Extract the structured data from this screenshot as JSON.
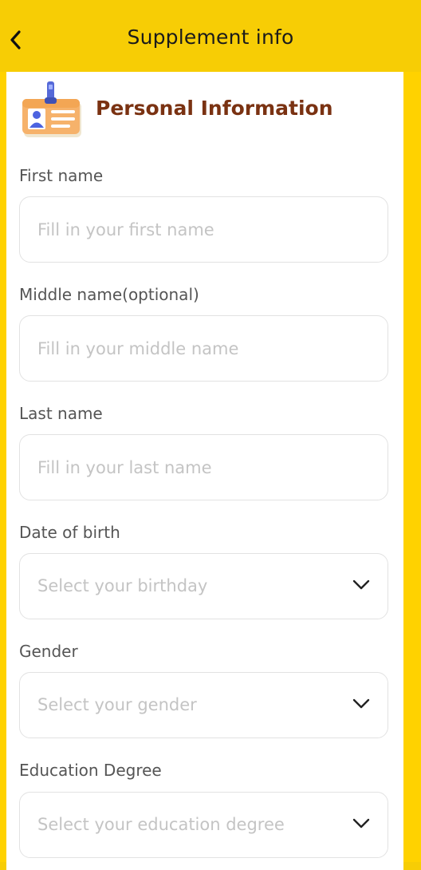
{
  "header": {
    "title": "Supplement info"
  },
  "section": {
    "title": "Personal Information"
  },
  "fields": {
    "first_name": {
      "label": "First name",
      "placeholder": "Fill in your first name"
    },
    "middle_name": {
      "label": "Middle name(optional)",
      "placeholder": "Fill in your middle name"
    },
    "last_name": {
      "label": "Last name",
      "placeholder": "Fill in your last name"
    },
    "birth": {
      "label": "Date of birth",
      "placeholder": "Select your birthday"
    },
    "gender": {
      "label": "Gender",
      "placeholder": "Select your gender"
    },
    "education": {
      "label": "Education Degree",
      "placeholder": "Select your education degree"
    }
  },
  "icons": {
    "back": "chevron-left-icon",
    "section": "id-card-icon",
    "dropdown": "chevron-down-icon"
  },
  "colors": {
    "header_bg": "#f7cd05",
    "section_title": "#7a3212",
    "label": "#555555",
    "placeholder": "#c4c4c4",
    "border": "#e2e2e2"
  }
}
